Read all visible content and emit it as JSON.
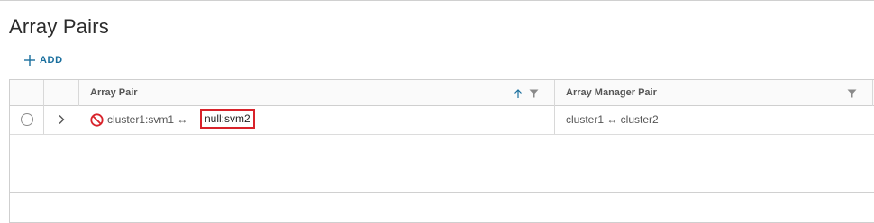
{
  "page": {
    "title": "Array Pairs"
  },
  "toolbar": {
    "add_label": "ADD",
    "add_icon": "plus-icon"
  },
  "grid": {
    "columns": [
      {
        "label": "Array Pair",
        "sort_icon": "arrow-up-icon",
        "filter_icon": "filter-icon"
      },
      {
        "label": "Array Manager Pair",
        "filter_icon": "filter-icon"
      }
    ],
    "rows": [
      {
        "selected": false,
        "status_icon": "prohibited-icon",
        "array_pair_left": "cluster1:svm1 ↔",
        "array_pair_right": "null:svm2",
        "array_manager_pair": "cluster1 ↔ cluster2"
      }
    ]
  },
  "colors": {
    "accent": "#1a6f9e",
    "error": "#d8222a",
    "highlight_border": "#d8222a"
  }
}
